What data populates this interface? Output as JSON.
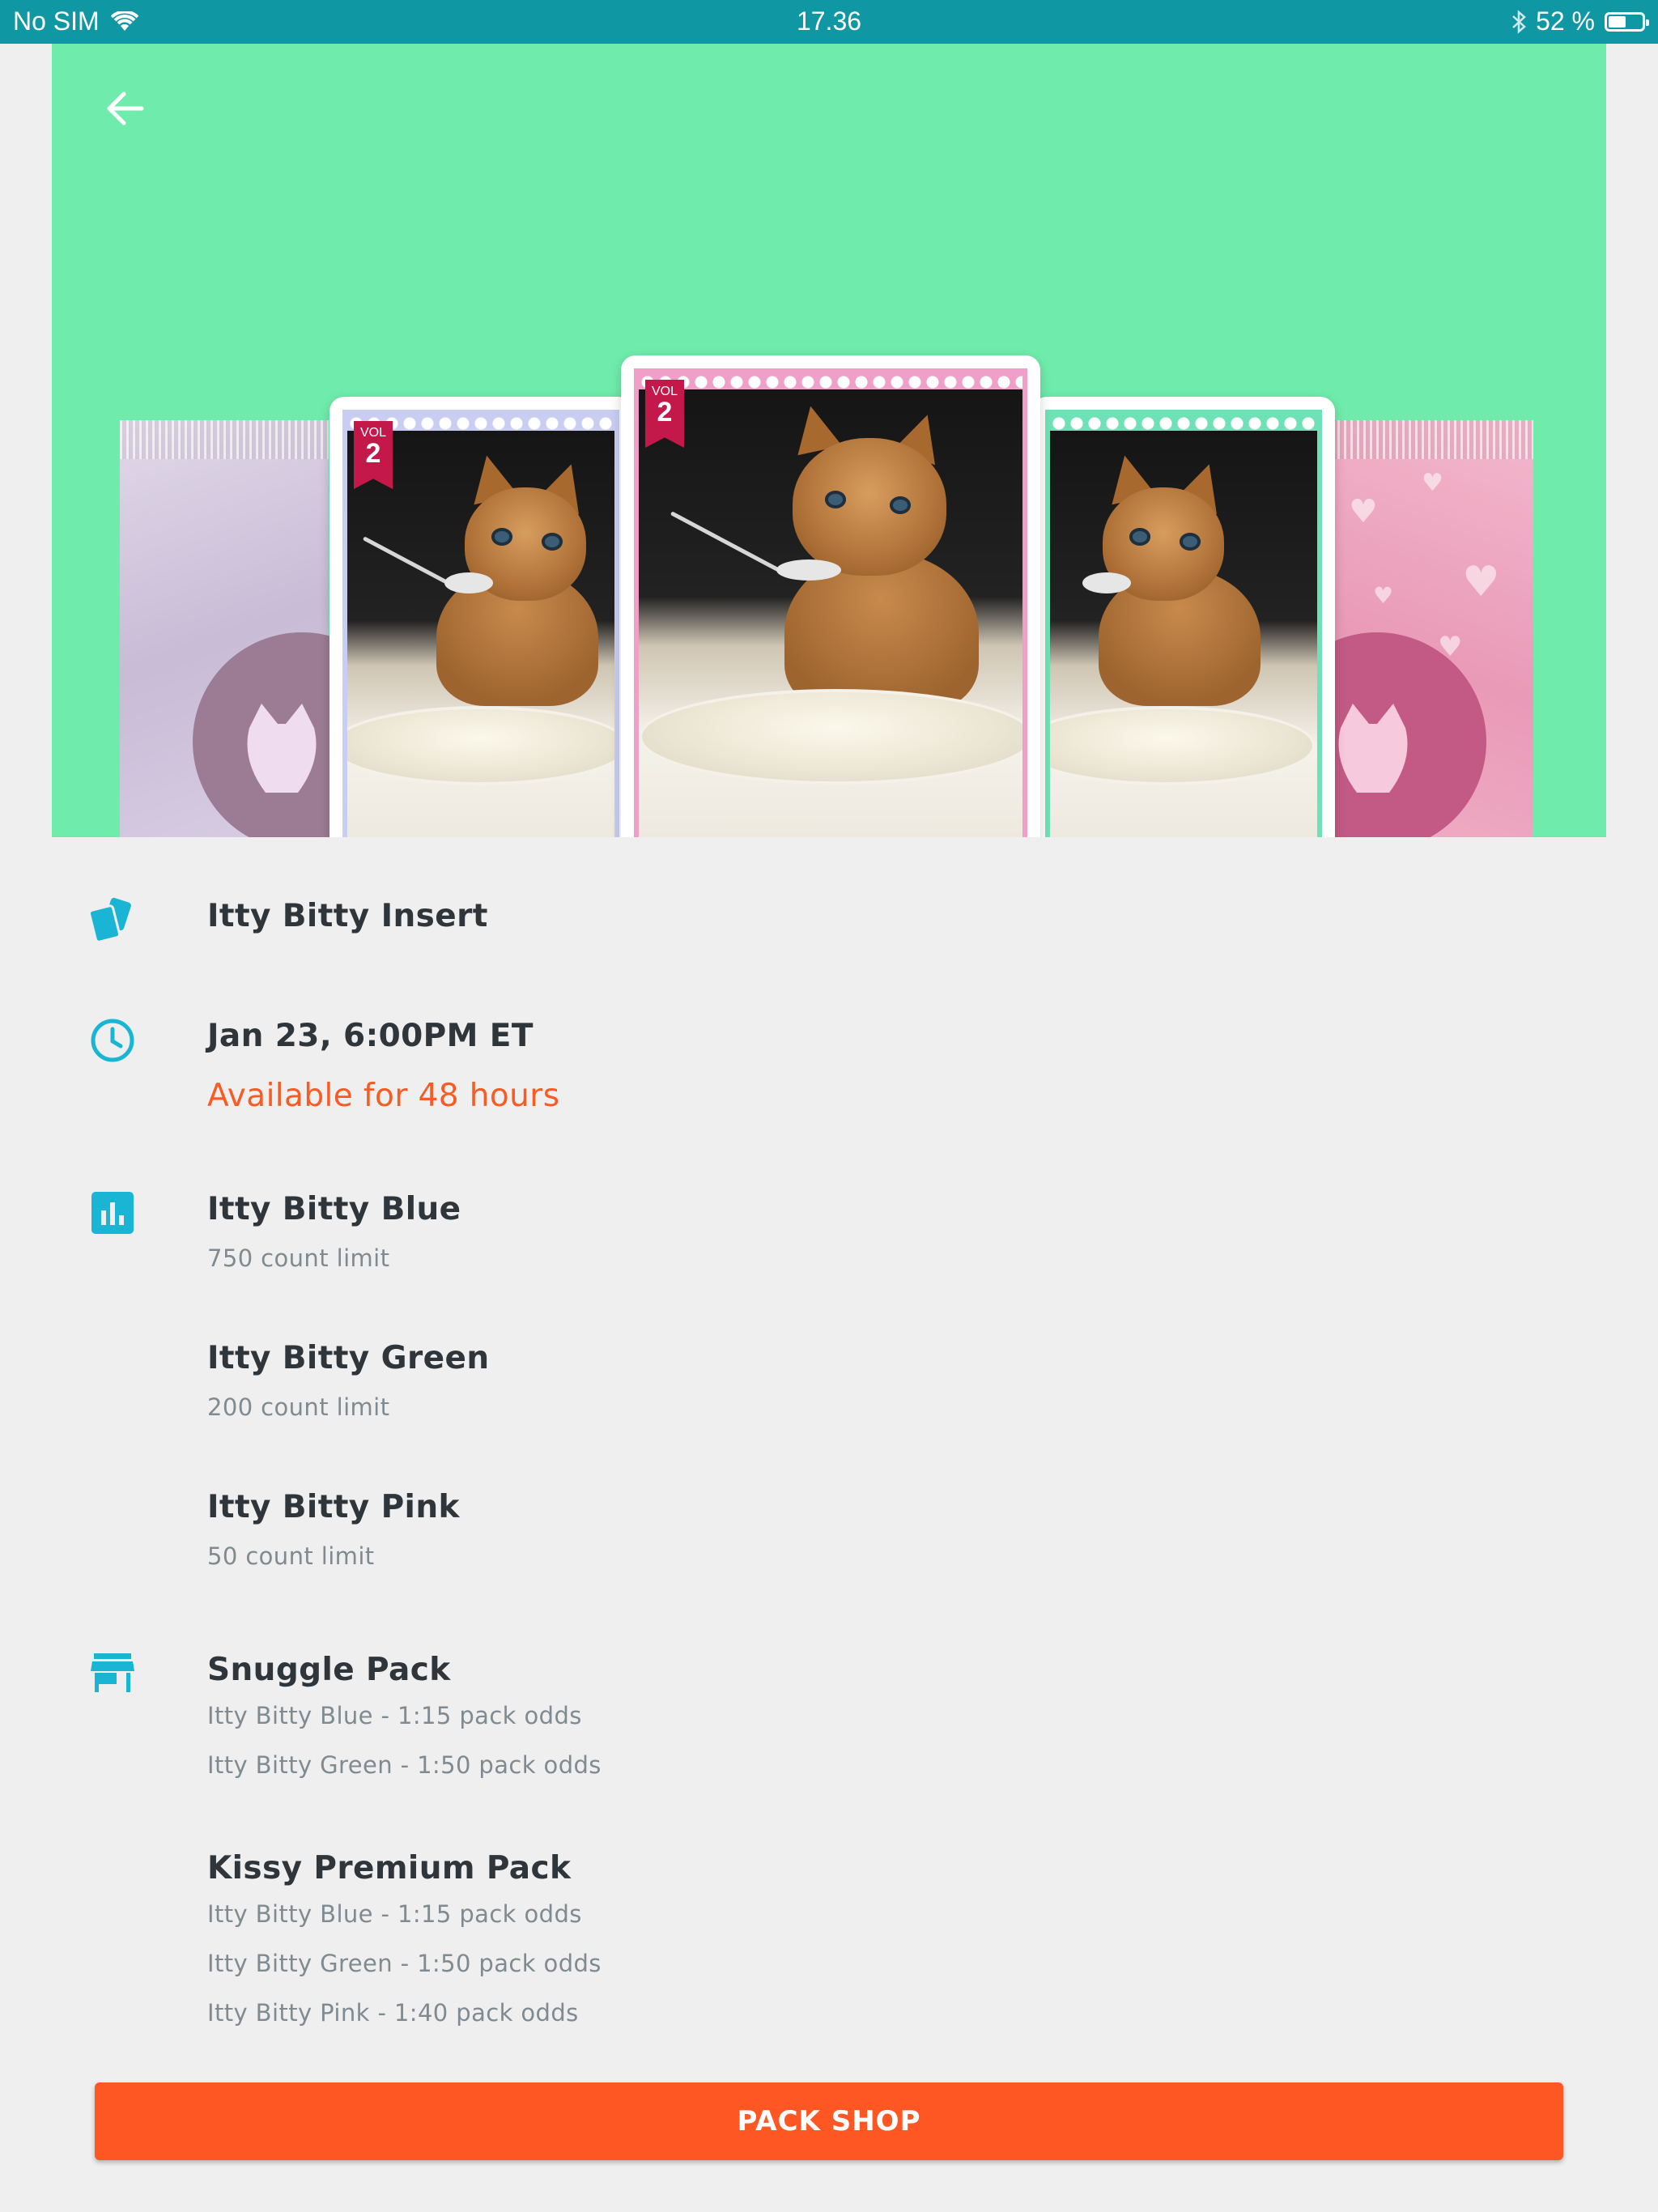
{
  "status_bar": {
    "carrier": "No SIM",
    "time": "17.36",
    "battery_text": "52 %",
    "battery_level": 0.52
  },
  "hero": {
    "card_volume_label": "VOL",
    "card_volume_number": "2",
    "background_color": "#6fecab"
  },
  "insert": {
    "icon": "cards-icon",
    "name": "Itty Bitty Insert"
  },
  "schedule": {
    "icon": "clock-icon",
    "date_time": "Jan 23, 6:00PM ET",
    "availability": "Available for 48 hours"
  },
  "limits": {
    "icon": "bar-chart-icon",
    "items": [
      {
        "name": "Itty Bitty Blue",
        "limit": "750 count limit"
      },
      {
        "name": "Itty Bitty Green",
        "limit": "200 count limit"
      },
      {
        "name": "Itty Bitty Pink",
        "limit": "50 count limit"
      }
    ]
  },
  "packs": {
    "icon": "store-icon",
    "items": [
      {
        "name": "Snuggle Pack",
        "odds": [
          "Itty Bitty Blue - 1:15 pack odds",
          "Itty Bitty Green - 1:50 pack odds"
        ]
      },
      {
        "name": "Kissy Premium Pack",
        "odds": [
          "Itty Bitty Blue - 1:15 pack odds",
          "Itty Bitty Green - 1:50 pack odds",
          "Itty Bitty Pink - 1:40 pack odds"
        ]
      }
    ]
  },
  "pack_shop_button": "PACK SHOP",
  "colors": {
    "status_bar": "#0f97a4",
    "accent": "#1ab4d4",
    "warning": "#f65c23",
    "button": "#fe5724",
    "page_background": "#efefef"
  }
}
